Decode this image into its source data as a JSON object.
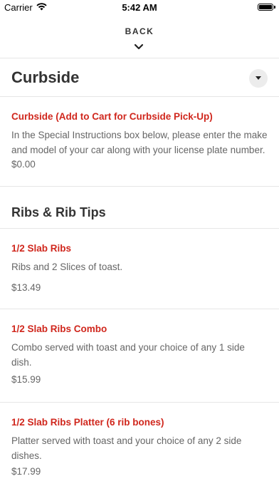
{
  "status_bar": {
    "carrier": "Carrier",
    "time": "5:42 AM"
  },
  "nav": {
    "back_label": "BACK"
  },
  "sections": [
    {
      "title": "Curbside",
      "items": [
        {
          "name": "Curbside (Add to Cart for Curbside Pick-Up)",
          "description": "In the Special Instructions box below, please enter the make and model of your car along with your license plate number.",
          "price": "$0.00"
        }
      ]
    },
    {
      "title": "Ribs & Rib Tips",
      "items": [
        {
          "name": "1/2 Slab Ribs",
          "description": "Ribs and 2 Slices of toast.",
          "price": "$13.49"
        },
        {
          "name": "1/2 Slab Ribs Combo",
          "description": "Combo served with toast and your choice of any 1 side dish.",
          "price": "$15.99"
        },
        {
          "name": "1/2 Slab Ribs Platter (6 rib bones)",
          "description": "Platter served with toast and your choice of any 2 side dishes.",
          "price": "$17.99"
        }
      ]
    }
  ],
  "colors": {
    "item_name": "#d0271d",
    "text_primary": "#333333",
    "text_secondary": "#666666",
    "divider": "#e6e6e6"
  },
  "icons": {
    "wifi": "wifi-icon",
    "battery": "battery-icon",
    "back": "chevron-down-icon",
    "dropdown": "caret-down-icon"
  }
}
